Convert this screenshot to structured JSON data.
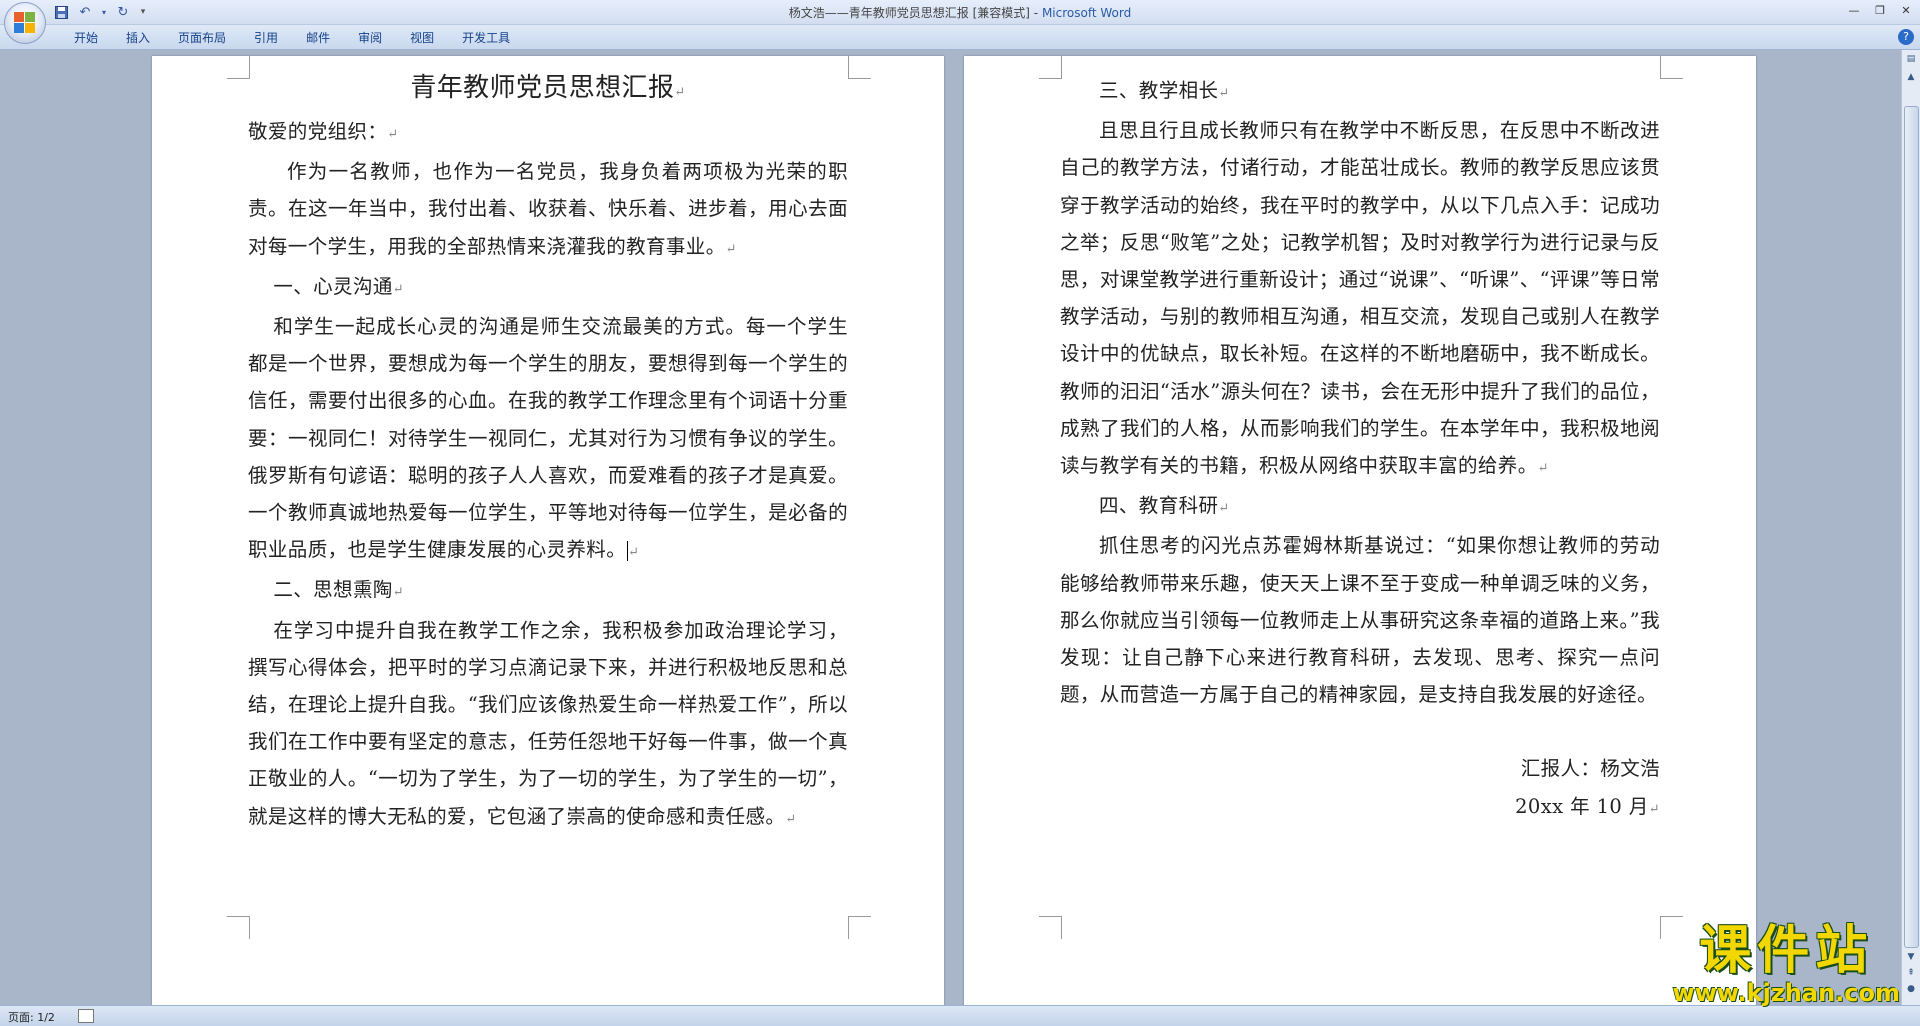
{
  "window": {
    "title_doc": "杨文浩——青年教师党员思想汇报 [兼容模式]",
    "title_sep": " - ",
    "title_app": "Microsoft Word"
  },
  "ribbon": {
    "tabs": [
      "开始",
      "插入",
      "页面布局",
      "引用",
      "邮件",
      "审阅",
      "视图",
      "开发工具"
    ]
  },
  "page1": {
    "title": "青年教师党员思想汇报",
    "salutation": "敬爱的党组织：",
    "intro": "作为一名教师，也作为一名党员，我身负着两项极为光荣的职责。在这一年当中，我付出着、收获着、快乐着、进步着，用心去面对每一个学生，用我的全部热情来浇灌我的教育事业。",
    "h1": "一、心灵沟通",
    "p1": "和学生一起成长心灵的沟通是师生交流最美的方式。每一个学生都是一个世界，要想成为每一个学生的朋友，要想得到每一个学生的信任，需要付出很多的心血。在我的教学工作理念里有个词语十分重要：一视同仁！对待学生一视同仁，尤其对行为习惯有争议的学生。俄罗斯有句谚语：聪明的孩子人人喜欢，而爱难看的孩子才是真爱。一个教师真诚地热爱每一位学生，平等地对待每一位学生，是必备的职业品质，也是学生健康发展的心灵养料。",
    "h2": "二、思想熏陶",
    "p2": "在学习中提升自我在教学工作之余，我积极参加政治理论学习，撰写心得体会，把平时的学习点滴记录下来，并进行积极地反思和总结，在理论上提升自我。“我们应该像热爱生命一样热爱工作”，所以我们在工作中要有坚定的意志，任劳任怨地干好每一件事，做一个真正敬业的人。“一切为了学生，为了一切的学生，为了学生的一切”，就是这样的博大无私的爱，它包涵了崇高的使命感和责任感。"
  },
  "page2": {
    "h3": "三、教学相长",
    "p3": "且思且行且成长教师只有在教学中不断反思，在反思中不断改进自己的教学方法，付诸行动，才能茁壮成长。教师的教学反思应该贯穿于教学活动的始终，我在平时的教学中，从以下几点入手：记成功之举；反思“败笔”之处；记教学机智；及时对教学行为进行记录与反思，对课堂教学进行重新设计；通过“说课”、“听课”、“评课”等日常教学活动，与别的教师相互沟通，相互交流，发现自己或别人在教学设计中的优缺点，取长补短。在这样的不断地磨砺中，我不断成长。教师的汩汩“活水”源头何在？读书，会在无形中提升了我们的品位，成熟了我们的人格，从而影响我们的学生。在本学年中，我积极地阅读与教学有关的书籍，积极从网络中获取丰富的给养。",
    "h4": "四、教育科研",
    "p4": "抓住思考的闪光点苏霍姆林斯基说过：“如果你想让教师的劳动能够给教师带来乐趣，使天天上课不至于变成一种单调乏味的义务，那么你就应当引领每一位教师走上从事研究这条幸福的道路上来。”我发现：让自己静下心来进行教育科研，去发现、思考、探究一点问题，从而营造一方属于自己的精神家园，是支持自我发展的好途径。",
    "signature": "汇报人：杨文浩",
    "date": "20xx 年 10 月"
  },
  "status": {
    "page_info": "页面: 1/2"
  },
  "watermark": {
    "text": "课件站",
    "url": "www.kjzhan.com"
  }
}
